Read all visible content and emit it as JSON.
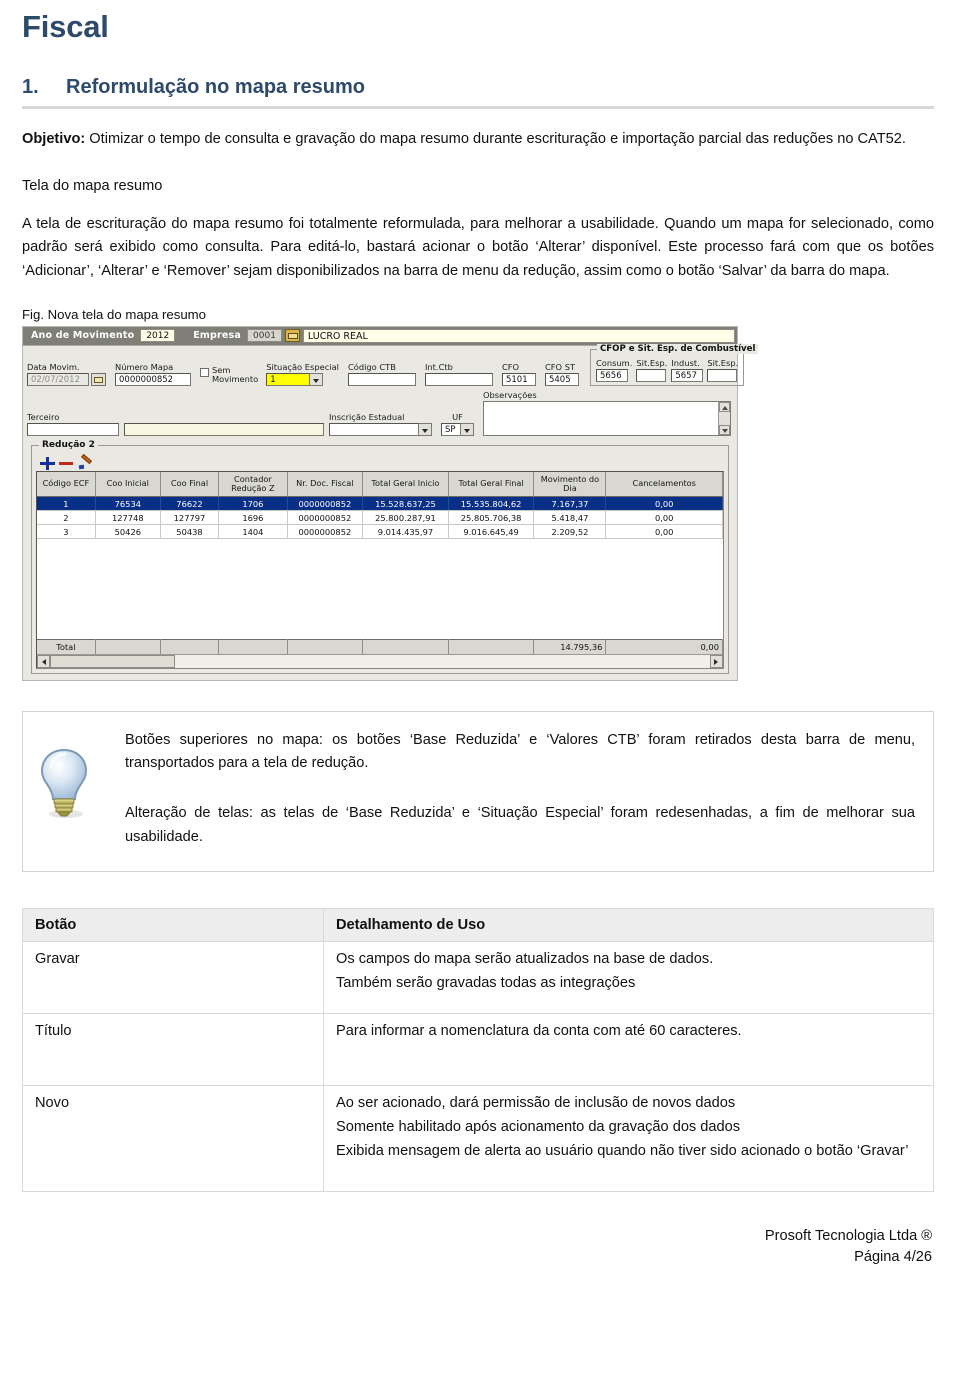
{
  "document": {
    "title": "Fiscal",
    "section": {
      "number": "1.",
      "heading": "Reformulação no mapa resumo"
    },
    "objective_label": "Objetivo:",
    "objective_text": " Otimizar o tempo de consulta e gravação do mapa resumo durante escrituração e importação parcial das reduções no CAT52.",
    "subhead": "Tela do mapa resumo",
    "paragraph": "A tela de escrituração do mapa resumo foi totalmente reformulada, para melhorar a usabilidade. Quando um mapa for selecionado, como padrão será exibido como consulta. Para editá-lo, bastará acionar o botão ‘Alterar’ disponível. Este processo fará com que os botões ‘Adicionar’, ‘Alterar’ e ‘Remover’ sejam disponibilizados na barra de menu da redução, assim como o botão ‘Salvar’ da barra do mapa.",
    "figure_caption": "Fig. Nova tela do mapa resumo",
    "accent_color": "#2e4a6b",
    "rule_color": "#d8d8d8"
  },
  "screenshot": {
    "titlebar": {
      "ano_label": "Ano de Movimento",
      "ano_value": "2012",
      "empresa_label": "Empresa",
      "empresa_value": "0001",
      "open_icon": "folder-open-icon",
      "company_name": "LUCRO REAL"
    },
    "form": {
      "data_movim_label": "Data Movim.",
      "data_movim_value": "02/07/2012",
      "numero_mapa_label": "Número Mapa",
      "numero_mapa_value": "0000000852",
      "sem_movimento_label_1": "Sem",
      "sem_movimento_label_2": "Movimento",
      "situacao_especial_label": "Situação Especial",
      "situacao_especial_value": "1",
      "codigo_ctb_label": "Código CTB",
      "codigo_ctb_value": "",
      "int_ctb_label": "Int.Ctb",
      "int_ctb_value": "",
      "cfo_label": "CFO",
      "cfo_value": "5101",
      "cfo_st_label": "CFO ST",
      "cfo_st_value": "5405",
      "combustivel_group": "CFOP e Sit. Esp. de Combustível",
      "consum_label": "Consum.",
      "consum_value": "5656",
      "sit_esp_label_1": "Sit.Esp.",
      "sit_esp_value_1": "",
      "indust_label": "Indust.",
      "indust_value": "5657",
      "sit_esp_label_2": "Sit.Esp.",
      "sit_esp_value_2": "",
      "terceiro_label": "Terceiro",
      "terceiro_code": "",
      "terceiro_name": "",
      "inscricao_estadual_label": "Inscrição Estadual",
      "inscricao_estadual_value": "",
      "uf_label": "UF",
      "uf_value": "SP",
      "observacoes_label": "Observações",
      "observacoes_value": ""
    },
    "reducao": {
      "group_title": "Redução 2",
      "toolbar": [
        {
          "name": "add-icon",
          "glyph": "+"
        },
        {
          "name": "remove-icon",
          "glyph": "−"
        },
        {
          "name": "edit-pencil-icon",
          "glyph": "✎"
        }
      ],
      "columns": [
        "Código ECF",
        "Coo Inicial",
        "Coo Final",
        "Contador Redução Z",
        "Nr. Doc. Fiscal",
        "Total Geral Inicio",
        "Total Geral Final",
        "Movimento do Dia",
        "Cancelamentos"
      ],
      "rows": [
        {
          "selected": true,
          "cells": [
            "1",
            "76534",
            "76622",
            "1706",
            "0000000852",
            "15.528.637,25",
            "15.535.804,62",
            "7.167,37",
            "0,00"
          ]
        },
        {
          "selected": false,
          "cells": [
            "2",
            "127748",
            "127797",
            "1696",
            "0000000852",
            "25.800.287,91",
            "25.805.706,38",
            "5.418,47",
            "0,00"
          ]
        },
        {
          "selected": false,
          "cells": [
            "3",
            "50426",
            "50438",
            "1404",
            "0000000852",
            "9.014.435,97",
            "9.016.645,49",
            "2.209,52",
            "0,00"
          ]
        }
      ],
      "total_row": {
        "label": "Total",
        "movimento_do_dia": "14.795,36",
        "cancelamentos": "0,00"
      }
    }
  },
  "tip": {
    "icon": "lightbulb-icon",
    "paragraphs": [
      "Botões superiores no mapa: os botões ‘Base Reduzida’ e ‘Valores CTB’ foram retirados desta barra de menu, transportados para a tela de redução.",
      "Alteração de telas: as telas de ‘Base Reduzida’ e ‘Situação Especial’ foram redesenhadas, a fim de melhorar sua usabilidade."
    ]
  },
  "button_table": {
    "headers": [
      "Botão",
      "Detalhamento de Uso"
    ],
    "rows": [
      {
        "button": "Gravar",
        "details": [
          "Os campos do mapa serão atualizados na base de dados.",
          "Também serão gravadas todas as integrações"
        ]
      },
      {
        "button": "Título",
        "details": [
          "Para informar a nomenclatura da conta com até 60 caracteres."
        ]
      },
      {
        "button": "Novo",
        "details": [
          "Ao ser acionado, dará permissão de inclusão de novos dados",
          "Somente habilitado após acionamento da gravação dos dados",
          "Exibida mensagem de alerta ao usuário quando não tiver sido acionado o botão ‘Gravar’"
        ]
      }
    ]
  },
  "footer": {
    "company": "Prosoft Tecnologia Ltda ®",
    "page": "Página 4/26"
  }
}
